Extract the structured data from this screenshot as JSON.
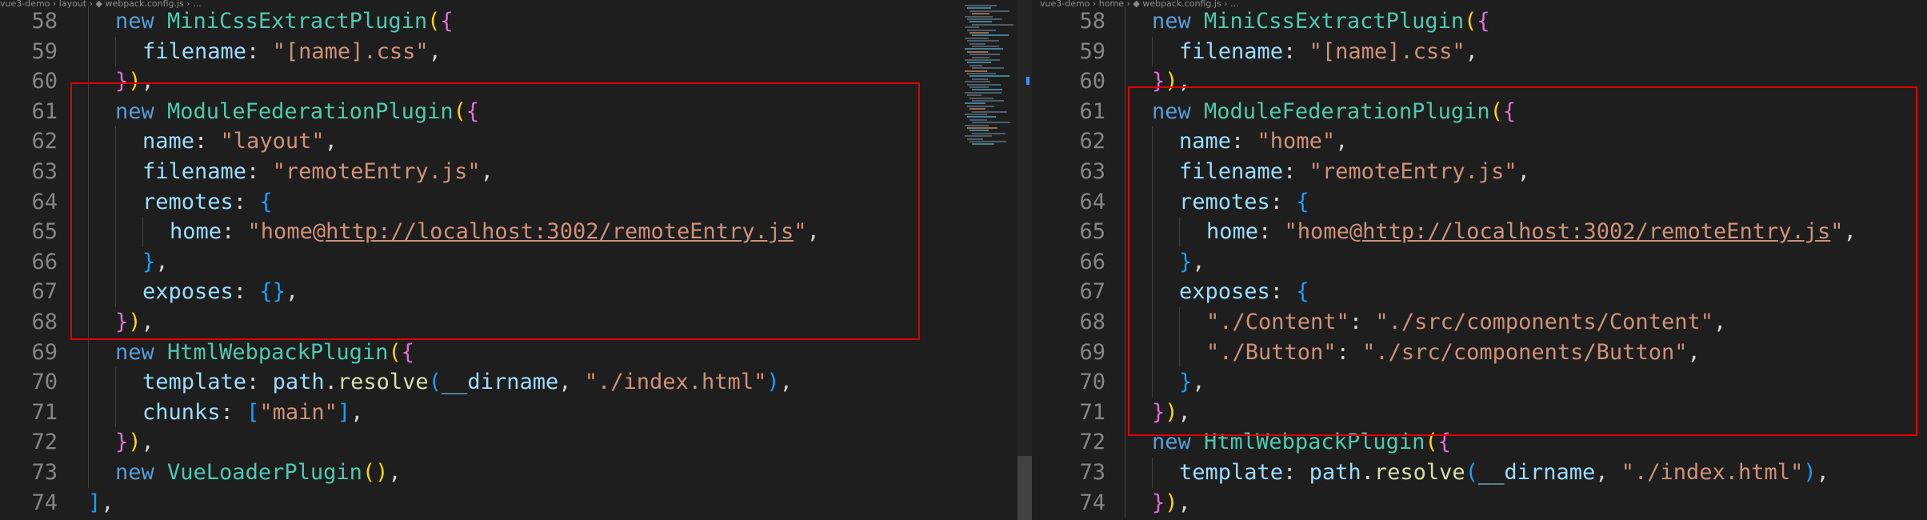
{
  "left": {
    "breadcrumb": "vue3-demo › layout › ◆ webpack.config.js › ...",
    "lines": [
      {
        "num": "58",
        "indent": 2,
        "tokens": [
          {
            "t": "new ",
            "c": "kw"
          },
          {
            "t": "MiniCssExtractPlugin",
            "c": "cls"
          },
          {
            "t": "(",
            "c": "b1"
          },
          {
            "t": "{",
            "c": "b2"
          }
        ]
      },
      {
        "num": "59",
        "indent": 3,
        "tokens": [
          {
            "t": "filename",
            "c": "prop"
          },
          {
            "t": ": ",
            "c": "punc"
          },
          {
            "t": "\"[name].css\"",
            "c": "str"
          },
          {
            "t": ",",
            "c": "punc"
          }
        ]
      },
      {
        "num": "60",
        "indent": 2,
        "tokens": [
          {
            "t": "}",
            "c": "b2"
          },
          {
            "t": ")",
            "c": "b1"
          },
          {
            "t": ",",
            "c": "punc"
          }
        ]
      },
      {
        "num": "61",
        "indent": 2,
        "tokens": [
          {
            "t": "new ",
            "c": "kw"
          },
          {
            "t": "ModuleFederationPlugin",
            "c": "cls"
          },
          {
            "t": "(",
            "c": "b1"
          },
          {
            "t": "{",
            "c": "b2"
          }
        ]
      },
      {
        "num": "62",
        "indent": 3,
        "tokens": [
          {
            "t": "name",
            "c": "prop"
          },
          {
            "t": ": ",
            "c": "punc"
          },
          {
            "t": "\"layout\"",
            "c": "str"
          },
          {
            "t": ",",
            "c": "punc"
          }
        ]
      },
      {
        "num": "63",
        "indent": 3,
        "tokens": [
          {
            "t": "filename",
            "c": "prop"
          },
          {
            "t": ": ",
            "c": "punc"
          },
          {
            "t": "\"remoteEntry.js\"",
            "c": "str"
          },
          {
            "t": ",",
            "c": "punc"
          }
        ]
      },
      {
        "num": "64",
        "indent": 3,
        "tokens": [
          {
            "t": "remotes",
            "c": "prop"
          },
          {
            "t": ": ",
            "c": "punc"
          },
          {
            "t": "{",
            "c": "b3"
          }
        ]
      },
      {
        "num": "65",
        "indent": 4,
        "tokens": [
          {
            "t": "home",
            "c": "prop"
          },
          {
            "t": ": ",
            "c": "punc"
          },
          {
            "t": "\"home@",
            "c": "str"
          },
          {
            "t": "http://localhost:3002/remoteEntry.js",
            "c": "link"
          },
          {
            "t": "\"",
            "c": "str"
          },
          {
            "t": ",",
            "c": "punc"
          }
        ]
      },
      {
        "num": "66",
        "indent": 3,
        "tokens": [
          {
            "t": "}",
            "c": "b3"
          },
          {
            "t": ",",
            "c": "punc"
          }
        ]
      },
      {
        "num": "67",
        "indent": 3,
        "tokens": [
          {
            "t": "exposes",
            "c": "prop"
          },
          {
            "t": ": ",
            "c": "punc"
          },
          {
            "t": "{}",
            "c": "b3"
          },
          {
            "t": ",",
            "c": "punc"
          }
        ]
      },
      {
        "num": "68",
        "indent": 2,
        "tokens": [
          {
            "t": "}",
            "c": "b2"
          },
          {
            "t": ")",
            "c": "b1"
          },
          {
            "t": ",",
            "c": "punc"
          }
        ]
      },
      {
        "num": "69",
        "indent": 2,
        "tokens": [
          {
            "t": "new ",
            "c": "kw"
          },
          {
            "t": "HtmlWebpackPlugin",
            "c": "cls"
          },
          {
            "t": "(",
            "c": "b1"
          },
          {
            "t": "{",
            "c": "b2"
          }
        ]
      },
      {
        "num": "70",
        "indent": 3,
        "tokens": [
          {
            "t": "template",
            "c": "prop"
          },
          {
            "t": ": ",
            "c": "punc"
          },
          {
            "t": "path",
            "c": "prop"
          },
          {
            "t": ".",
            "c": "punc"
          },
          {
            "t": "resolve",
            "c": "fn"
          },
          {
            "t": "(",
            "c": "b3"
          },
          {
            "t": "__dirname",
            "c": "prop"
          },
          {
            "t": ", ",
            "c": "punc"
          },
          {
            "t": "\"./index.html\"",
            "c": "str"
          },
          {
            "t": ")",
            "c": "b3"
          },
          {
            "t": ",",
            "c": "punc"
          }
        ]
      },
      {
        "num": "71",
        "indent": 3,
        "tokens": [
          {
            "t": "chunks",
            "c": "prop"
          },
          {
            "t": ": ",
            "c": "punc"
          },
          {
            "t": "[",
            "c": "b3"
          },
          {
            "t": "\"main\"",
            "c": "str"
          },
          {
            "t": "]",
            "c": "b3"
          },
          {
            "t": ",",
            "c": "punc"
          }
        ]
      },
      {
        "num": "72",
        "indent": 2,
        "tokens": [
          {
            "t": "}",
            "c": "b2"
          },
          {
            "t": ")",
            "c": "b1"
          },
          {
            "t": ",",
            "c": "punc"
          }
        ]
      },
      {
        "num": "73",
        "indent": 2,
        "tokens": [
          {
            "t": "new ",
            "c": "kw"
          },
          {
            "t": "VueLoaderPlugin",
            "c": "cls"
          },
          {
            "t": "(",
            "c": "b1"
          },
          {
            "t": ")",
            "c": "b1"
          },
          {
            "t": ",",
            "c": "punc"
          }
        ]
      },
      {
        "num": "74",
        "indent": 1,
        "tokens": [
          {
            "t": "]",
            "c": "b3"
          },
          {
            "t": ",",
            "c": "punc"
          }
        ]
      }
    ]
  },
  "right": {
    "breadcrumb": "vue3-demo › home › ◆ webpack.config.js › ...",
    "lines": [
      {
        "num": "58",
        "indent": 2,
        "tokens": [
          {
            "t": "new ",
            "c": "kw"
          },
          {
            "t": "MiniCssExtractPlugin",
            "c": "cls"
          },
          {
            "t": "(",
            "c": "b1"
          },
          {
            "t": "{",
            "c": "b2"
          }
        ]
      },
      {
        "num": "59",
        "indent": 3,
        "tokens": [
          {
            "t": "filename",
            "c": "prop"
          },
          {
            "t": ": ",
            "c": "punc"
          },
          {
            "t": "\"[name].css\"",
            "c": "str"
          },
          {
            "t": ",",
            "c": "punc"
          }
        ]
      },
      {
        "num": "60",
        "indent": 2,
        "tokens": [
          {
            "t": "}",
            "c": "b2"
          },
          {
            "t": ")",
            "c": "b1"
          },
          {
            "t": ",",
            "c": "punc"
          }
        ]
      },
      {
        "num": "61",
        "indent": 2,
        "tokens": [
          {
            "t": "new ",
            "c": "kw"
          },
          {
            "t": "ModuleFederationPlugin",
            "c": "cls"
          },
          {
            "t": "(",
            "c": "b1"
          },
          {
            "t": "{",
            "c": "b2"
          }
        ]
      },
      {
        "num": "62",
        "indent": 3,
        "tokens": [
          {
            "t": "name",
            "c": "prop"
          },
          {
            "t": ": ",
            "c": "punc"
          },
          {
            "t": "\"home\"",
            "c": "str"
          },
          {
            "t": ",",
            "c": "punc"
          }
        ]
      },
      {
        "num": "63",
        "indent": 3,
        "tokens": [
          {
            "t": "filename",
            "c": "prop"
          },
          {
            "t": ": ",
            "c": "punc"
          },
          {
            "t": "\"remoteEntry.js\"",
            "c": "str"
          },
          {
            "t": ",",
            "c": "punc"
          }
        ]
      },
      {
        "num": "64",
        "indent": 3,
        "tokens": [
          {
            "t": "remotes",
            "c": "prop"
          },
          {
            "t": ": ",
            "c": "punc"
          },
          {
            "t": "{",
            "c": "b3"
          }
        ]
      },
      {
        "num": "65",
        "indent": 4,
        "tokens": [
          {
            "t": "home",
            "c": "prop"
          },
          {
            "t": ": ",
            "c": "punc"
          },
          {
            "t": "\"home@",
            "c": "str"
          },
          {
            "t": "http://localhost:3002/remoteEntry.js",
            "c": "link"
          },
          {
            "t": "\"",
            "c": "str"
          },
          {
            "t": ",",
            "c": "punc"
          }
        ]
      },
      {
        "num": "66",
        "indent": 3,
        "tokens": [
          {
            "t": "}",
            "c": "b3"
          },
          {
            "t": ",",
            "c": "punc"
          }
        ]
      },
      {
        "num": "67",
        "indent": 3,
        "tokens": [
          {
            "t": "exposes",
            "c": "prop"
          },
          {
            "t": ": ",
            "c": "punc"
          },
          {
            "t": "{",
            "c": "b3"
          }
        ]
      },
      {
        "num": "68",
        "indent": 4,
        "tokens": [
          {
            "t": "\"./Content\"",
            "c": "str"
          },
          {
            "t": ": ",
            "c": "punc"
          },
          {
            "t": "\"./src/components/Content\"",
            "c": "str"
          },
          {
            "t": ",",
            "c": "punc"
          }
        ]
      },
      {
        "num": "69",
        "indent": 4,
        "tokens": [
          {
            "t": "\"./Button\"",
            "c": "str"
          },
          {
            "t": ": ",
            "c": "punc"
          },
          {
            "t": "\"./src/components/Button\"",
            "c": "str"
          },
          {
            "t": ",",
            "c": "punc"
          }
        ]
      },
      {
        "num": "70",
        "indent": 3,
        "tokens": [
          {
            "t": "}",
            "c": "b3"
          },
          {
            "t": ",",
            "c": "punc"
          }
        ]
      },
      {
        "num": "71",
        "indent": 2,
        "tokens": [
          {
            "t": "}",
            "c": "b2"
          },
          {
            "t": ")",
            "c": "b1"
          },
          {
            "t": ",",
            "c": "punc"
          }
        ]
      },
      {
        "num": "72",
        "indent": 2,
        "tokens": [
          {
            "t": "new ",
            "c": "kw"
          },
          {
            "t": "HtmlWebpackPlugin",
            "c": "cls"
          },
          {
            "t": "(",
            "c": "b1"
          },
          {
            "t": "{",
            "c": "b2"
          }
        ]
      },
      {
        "num": "73",
        "indent": 3,
        "tokens": [
          {
            "t": "template",
            "c": "prop"
          },
          {
            "t": ": ",
            "c": "punc"
          },
          {
            "t": "path",
            "c": "prop"
          },
          {
            "t": ".",
            "c": "punc"
          },
          {
            "t": "resolve",
            "c": "fn"
          },
          {
            "t": "(",
            "c": "b3"
          },
          {
            "t": "__dirname",
            "c": "prop"
          },
          {
            "t": ", ",
            "c": "punc"
          },
          {
            "t": "\"./index.html\"",
            "c": "str"
          },
          {
            "t": ")",
            "c": "b3"
          },
          {
            "t": ",",
            "c": "punc"
          }
        ]
      },
      {
        "num": "74",
        "indent": 2,
        "tokens": [
          {
            "t": "}",
            "c": "b2"
          },
          {
            "t": ")",
            "c": "b1"
          },
          {
            "t": ",",
            "c": "punc"
          }
        ]
      }
    ]
  },
  "colors": {
    "background": "#1e1e1e",
    "highlight_box": "#e00000",
    "keyword": "#569cd6",
    "class": "#4ec9b0",
    "property": "#9cdcfe",
    "string": "#ce9178"
  }
}
